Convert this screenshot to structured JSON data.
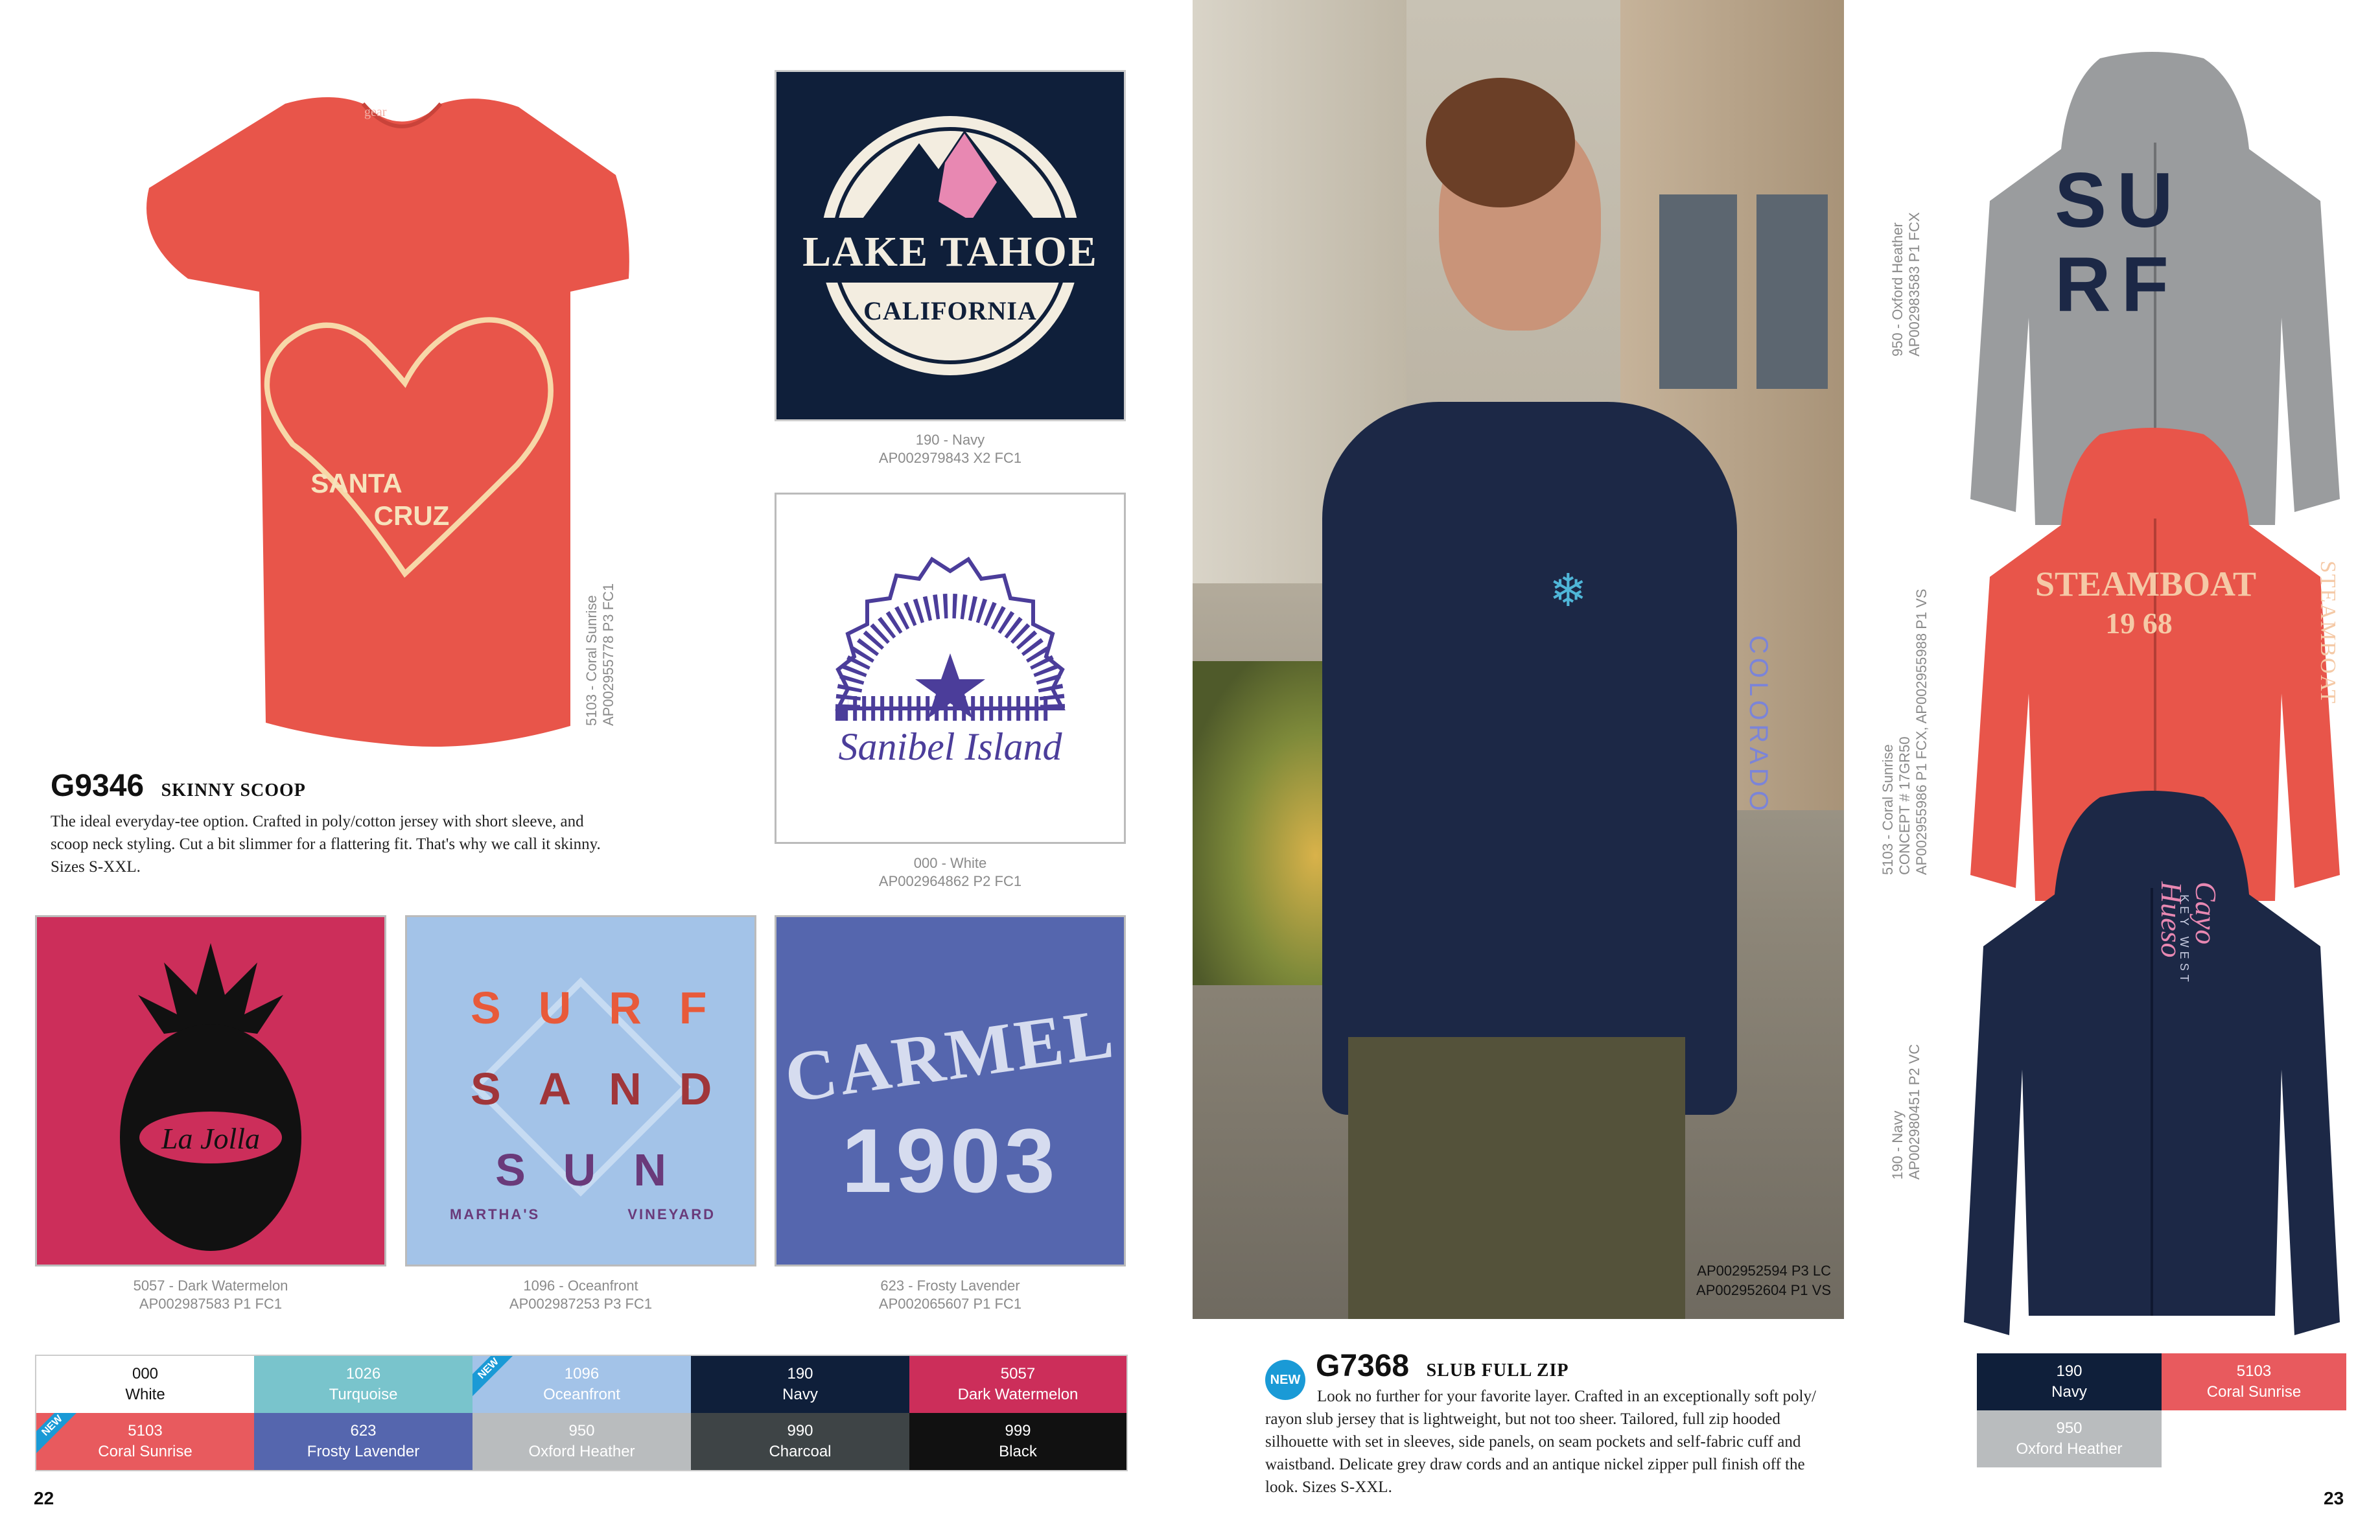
{
  "left_page": {
    "page_number": "22",
    "product": {
      "code": "G9346",
      "name": "SKINNY SCOOP",
      "description_lines": [
        "The ideal everyday-tee option. Crafted in poly/cotton jersey with short sleeve, and",
        "scoop neck styling. Cut a bit slimmer for a flattering fit. That's why we call it skinny.",
        "Sizes S-XXL."
      ]
    },
    "tee": {
      "color": "#e8554a",
      "caption_line1": "5103 - Coral Sunrise",
      "caption_line2": "AP002955778 P3 FC1",
      "brand_label": "gear"
    },
    "designs": [
      {
        "id": "lake-tahoe",
        "bg": "#0f1f3a",
        "art_line1": "LAKE TAHOE",
        "art_line2": "CALIFORNIA",
        "caption_line1": "190 - Navy",
        "caption_line2": "AP002979843 X2 FC1"
      },
      {
        "id": "sanibel",
        "bg": "#ffffff",
        "art_line1": "Sanibel Island",
        "caption_line1": "000 - White",
        "caption_line2": "AP002964862 P2 FC1"
      },
      {
        "id": "la-jolla",
        "bg": "#cc2e5a",
        "art_line1": "La Jolla",
        "caption_line1": "5057 - Dark Watermelon",
        "caption_line2": "AP002987583 P1 FC1"
      },
      {
        "id": "marthas-vineyard",
        "bg": "#a3c3e8",
        "art_line1": "SURF",
        "art_line2": "SAND",
        "art_line3": "SUN",
        "art_line4": "MARTHA'S",
        "art_line5": "VINEYARD",
        "caption_line1": "1096 - Oceanfront",
        "caption_line2": "AP002987253 P3 FC1"
      },
      {
        "id": "carmel",
        "bg": "#5566ae",
        "art_line1": "CARMEL",
        "art_line2": "1903",
        "caption_line1": "623 - Frosty Lavender",
        "caption_line2": "AP002065607 P1 FC1"
      }
    ],
    "swatches": [
      {
        "code": "000",
        "name": "White",
        "bg": "#ffffff",
        "fg": "#111111",
        "new": false
      },
      {
        "code": "1026",
        "name": "Turquoise",
        "bg": "#79c4cc",
        "fg": "#ffffff",
        "new": false
      },
      {
        "code": "1096",
        "name": "Oceanfront",
        "bg": "#a3c3e8",
        "fg": "#ffffff",
        "new": true
      },
      {
        "code": "190",
        "name": "Navy",
        "bg": "#0f1f3a",
        "fg": "#ffffff",
        "new": false
      },
      {
        "code": "5057",
        "name": "Dark Watermelon",
        "bg": "#cc2e5a",
        "fg": "#ffffff",
        "new": false
      },
      {
        "code": "5103",
        "name": "Coral Sunrise",
        "bg": "#e85a5e",
        "fg": "#ffffff",
        "new": true
      },
      {
        "code": "623",
        "name": "Frosty Lavender",
        "bg": "#5566ae",
        "fg": "#ffffff",
        "new": false
      },
      {
        "code": "950",
        "name": "Oxford Heather",
        "bg": "#b9bcbe",
        "fg": "#ffffff",
        "new": false
      },
      {
        "code": "990",
        "name": "Charcoal",
        "bg": "#3e4446",
        "fg": "#ffffff",
        "new": false
      },
      {
        "code": "999",
        "name": "Black",
        "bg": "#111111",
        "fg": "#ffffff",
        "new": false
      }
    ],
    "new_label": "NEW"
  },
  "right_page": {
    "page_number": "23",
    "photo": {
      "caption_line1": "AP002952594 P3 LC",
      "caption_line2": "AP002952604 P1 VS",
      "sleeve_text": "COLORADO"
    },
    "product": {
      "code": "G7368",
      "name": "SLUB FULL ZIP",
      "new_badge": "NEW",
      "description_lines": [
        "Look no further for your favorite layer. Crafted in an exceptionally soft poly/",
        "rayon slub jersey that is lightweight, but not too sheer. Tailored, full zip hooded",
        "silhouette with set in sleeves, side panels, on seam pockets and self-fabric cuff and",
        "waistband. Delicate grey draw cords and an antique nickel zipper pull finish off the",
        "look. Sizes S-XXL."
      ]
    },
    "hoodies": [
      {
        "id": "surf",
        "color": "#9a9c9e",
        "art_line1": "SU",
        "art_line2": "RF",
        "caption_line1": "950 - Oxford Heather",
        "caption_line2": "AP002983583 P1 FCX"
      },
      {
        "id": "steamboat",
        "color": "#e8554a",
        "art_line1": "STEAMBOAT",
        "art_line2": "19 68",
        "sleeve_text": "STEAMBOAT",
        "caption_line1": "5103 - Coral Sunrise",
        "caption_line2": "CONCEPT # 17GR50",
        "caption_line3": "AP002955986 P1 FCX, AP002955988 P1 VS"
      },
      {
        "id": "key-west",
        "color": "#1c2846",
        "art_line1": "Cayo Hueso",
        "art_line2": "KEY WEST",
        "caption_line1": "190 - Navy",
        "caption_line2": "AP002980451 P2 VC"
      }
    ],
    "swatches": [
      {
        "code": "190",
        "name": "Navy",
        "bg": "#0f1f3a",
        "fg": "#ffffff"
      },
      {
        "code": "5103",
        "name": "Coral Sunrise",
        "bg": "#e85a5e",
        "fg": "#ffffff"
      },
      {
        "code": "950",
        "name": "Oxford Heather",
        "bg": "#b9bcbe",
        "fg": "#ffffff"
      }
    ]
  }
}
